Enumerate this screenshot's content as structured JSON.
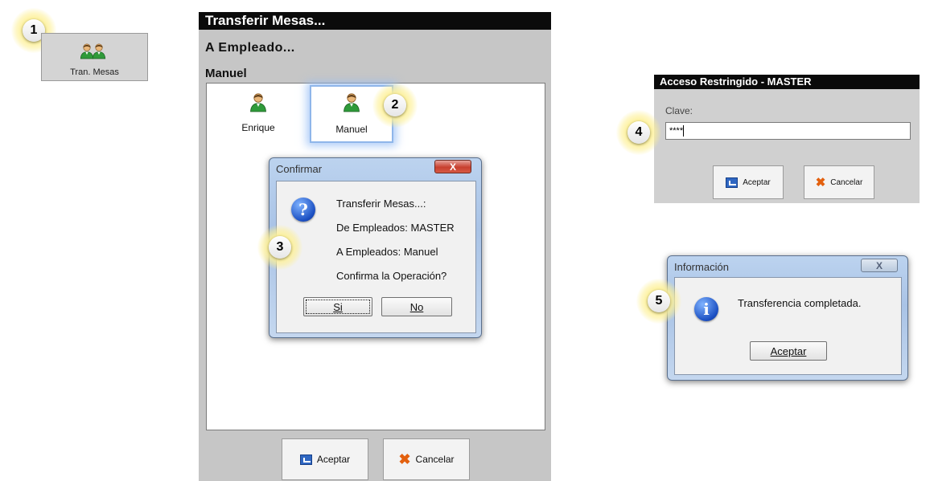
{
  "markers": [
    "1",
    "2",
    "3",
    "4",
    "5"
  ],
  "toolbar": {
    "tran_mesas_label": "Tran. Mesas"
  },
  "transfer_window": {
    "title": "Transferir Mesas...",
    "subtitle": "A Empleado...",
    "selected_employee": "Manuel",
    "employees": [
      {
        "name": "Enrique",
        "selected": false
      },
      {
        "name": "Manuel",
        "selected": true
      }
    ],
    "accept_label": "Aceptar",
    "cancel_label": "Cancelar"
  },
  "confirm_dialog": {
    "title": "Confirmar",
    "close_label": "X",
    "lines": [
      "Transferir Mesas...:",
      "De Empleados: MASTER",
      "A Empleados: Manuel",
      "Confirma la Operación?"
    ],
    "yes_label": "Si",
    "no_label": "No"
  },
  "restricted_dialog": {
    "title": "Acceso Restringido - MASTER",
    "password_label": "Clave:",
    "password_value": "****",
    "accept_label": "Aceptar",
    "cancel_label": "Cancelar"
  },
  "info_dialog": {
    "title": "Información",
    "close_label": "X",
    "message": "Transferencia completada.",
    "accept_label": "Aceptar"
  },
  "colors": {
    "title_bar": "#0b0b0b",
    "window_gray": "#c6c6c6",
    "vista_frame": "#a9c3e6",
    "marker_glow": "#fdf19a"
  }
}
